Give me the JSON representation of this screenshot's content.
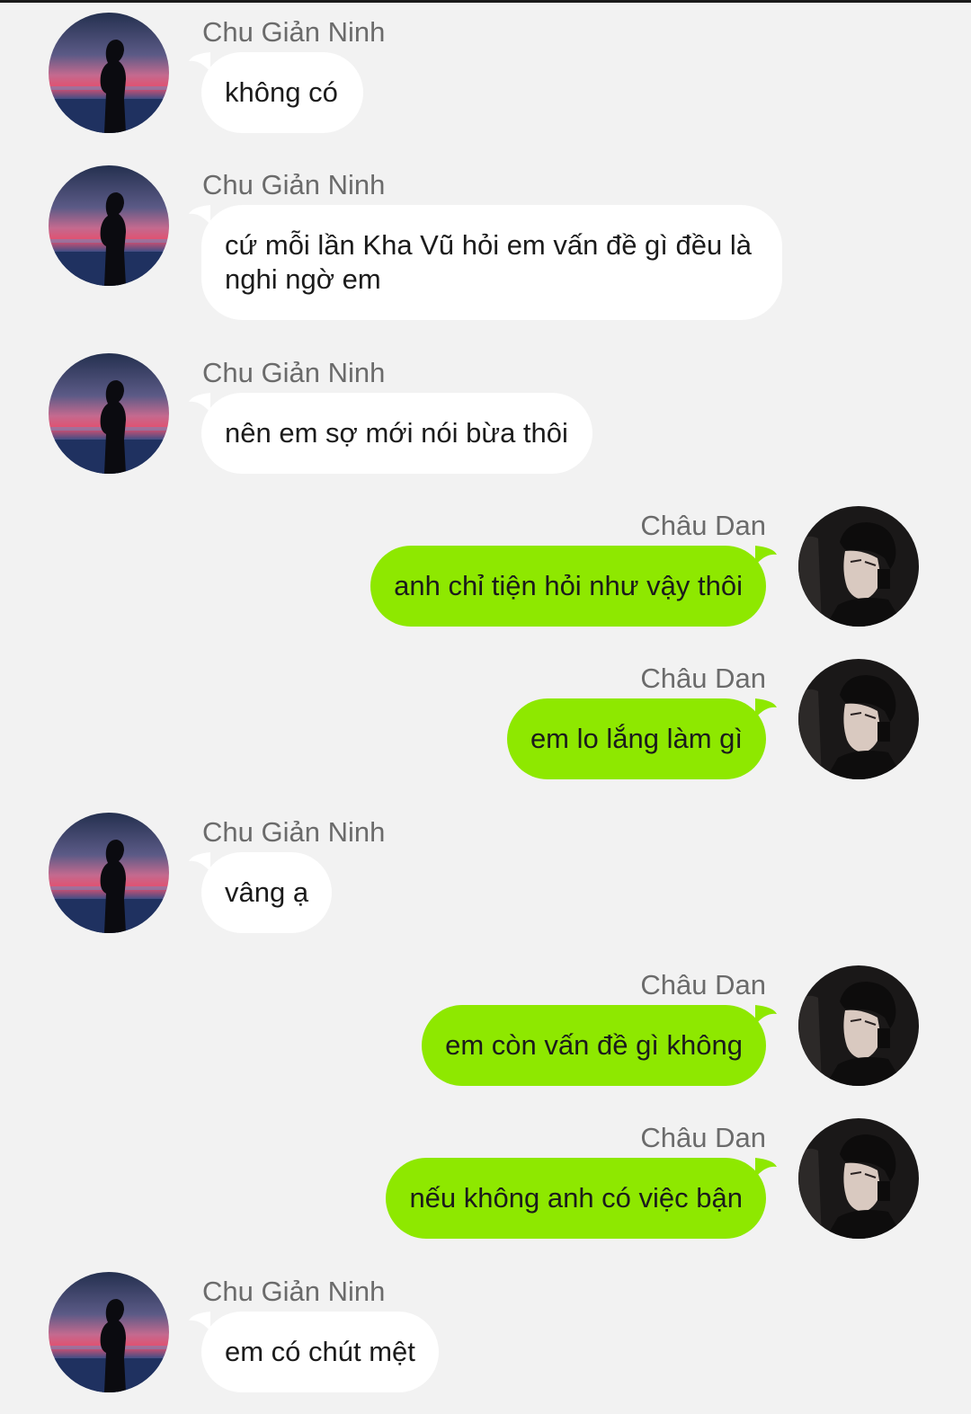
{
  "colors": {
    "background": "#f2f2f2",
    "incoming_bubble": "#ffffff",
    "outgoing_bubble": "#8ee800",
    "sender_text": "#6b6b6b"
  },
  "messages": [
    {
      "side": "left",
      "sender": "Chu Giản Ninh",
      "text": "không có",
      "avatar": "sunset-silhouette-avatar"
    },
    {
      "side": "left",
      "sender": "Chu Giản Ninh",
      "text": "cứ mỗi lần Kha Vũ hỏi em vấn đề gì đều là nghi ngờ em",
      "avatar": "sunset-silhouette-avatar"
    },
    {
      "side": "left",
      "sender": "Chu Giản Ninh",
      "text": "nên em sợ mới nói bừa thôi",
      "avatar": "sunset-silhouette-avatar"
    },
    {
      "side": "right",
      "sender": "Châu Dan",
      "text": "anh chỉ tiện hỏi như vậy thôi",
      "avatar": "dark-portrait-avatar"
    },
    {
      "side": "right",
      "sender": "Châu Dan",
      "text": "em lo lắng làm gì",
      "avatar": "dark-portrait-avatar"
    },
    {
      "side": "left",
      "sender": "Chu Giản Ninh",
      "text": "vâng ạ",
      "avatar": "sunset-silhouette-avatar"
    },
    {
      "side": "right",
      "sender": "Châu Dan",
      "text": "em còn vấn đề gì không",
      "avatar": "dark-portrait-avatar"
    },
    {
      "side": "right",
      "sender": "Châu Dan",
      "text": "nếu không anh có việc bận",
      "avatar": "dark-portrait-avatar"
    },
    {
      "side": "left",
      "sender": "Chu Giản Ninh",
      "text": "em có chút mệt",
      "avatar": "sunset-silhouette-avatar"
    }
  ]
}
